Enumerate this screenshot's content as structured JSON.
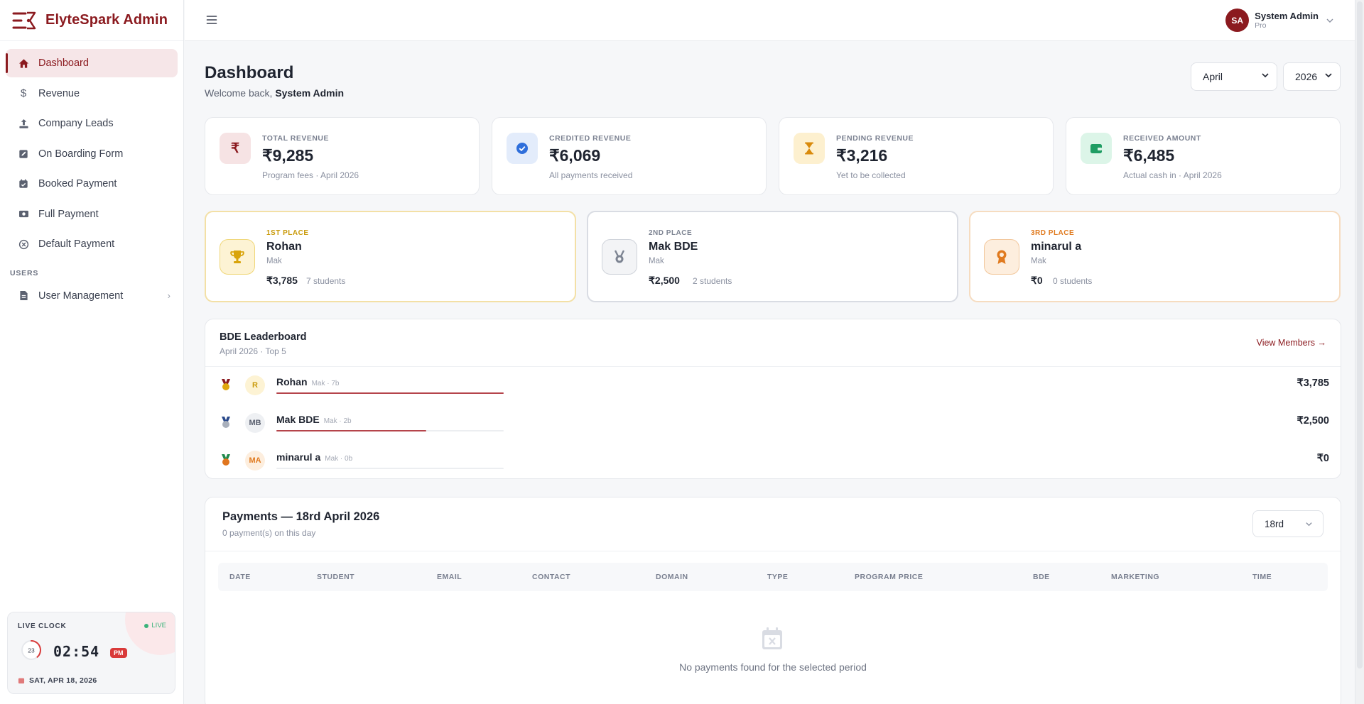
{
  "app": {
    "title": "ElyteSpark Admin"
  },
  "sidebar": {
    "items": [
      {
        "label": "Dashboard",
        "icon": "home-icon",
        "active": true
      },
      {
        "label": "Revenue",
        "icon": "dollar-icon"
      },
      {
        "label": "Company Leads",
        "icon": "upload-icon"
      },
      {
        "label": "On Boarding Form",
        "icon": "edit-icon"
      },
      {
        "label": "Booked Payment",
        "icon": "calendar-icon"
      },
      {
        "label": "Full Payment",
        "icon": "money-icon"
      },
      {
        "label": "Default Payment",
        "icon": "x-circle-icon"
      }
    ],
    "section_label": "USERS",
    "user_management": {
      "label": "User Management",
      "icon": "document-icon"
    }
  },
  "clock": {
    "label": "LIVE CLOCK",
    "live": "LIVE",
    "seconds": "23",
    "time": "02:54",
    "ampm": "PM",
    "date": "SAT, APR 18, 2026"
  },
  "header": {
    "user": {
      "initials": "SA",
      "name": "System Admin",
      "role": "Pro"
    }
  },
  "page": {
    "title": "Dashboard",
    "welcome_prefix": "Welcome back,",
    "welcome_name": "System Admin",
    "month_select": "April",
    "year_select": "2026"
  },
  "stats": [
    {
      "label": "TOTAL REVENUE",
      "value": "₹9,285",
      "sub": "Program fees · April 2026",
      "icon": "rupee-icon",
      "color": "#8b1a1f"
    },
    {
      "label": "CREDITED REVENUE",
      "value": "₹6,069",
      "sub": "All payments received",
      "icon": "check-circle-icon",
      "color": "#2f6fdb"
    },
    {
      "label": "PENDING REVENUE",
      "value": "₹3,216",
      "sub": "Yet to be collected",
      "icon": "hourglass-icon",
      "color": "#d98a0b"
    },
    {
      "label": "RECEIVED AMOUNT",
      "value": "₹6,485",
      "sub": "Actual cash in · April 2026",
      "icon": "wallet-icon",
      "color": "#1f9d63"
    }
  ],
  "podium": [
    {
      "rank": "1ST PLACE",
      "name": "Rohan",
      "team": "Mak",
      "amount": "₹3,785",
      "students": "7 students",
      "icon": "trophy-icon",
      "color": "#c99a0a"
    },
    {
      "rank": "2ND PLACE",
      "name": "Mak BDE",
      "team": "Mak",
      "amount": "₹2,500",
      "students": "2 students",
      "icon": "medal-icon",
      "color": "#7d8492"
    },
    {
      "rank": "3RD PLACE",
      "name": "minarul a",
      "team": "Mak",
      "amount": "₹0",
      "students": "0 students",
      "icon": "award-icon",
      "color": "#e07a1f"
    }
  ],
  "leaderboard": {
    "title": "BDE Leaderboard",
    "subtitle": "April 2026 · Top 5",
    "link": "View Members →",
    "rows": [
      {
        "initials": "R",
        "name": "Rohan",
        "meta": "Mak · 7b",
        "amount": "₹3,785",
        "progress": 1.0
      },
      {
        "initials": "MB",
        "name": "Mak BDE",
        "meta": "Mak · 2b",
        "amount": "₹2,500",
        "progress": 0.66
      },
      {
        "initials": "MA",
        "name": "minarul a",
        "meta": "Mak · 0b",
        "amount": "₹0",
        "progress": 0
      }
    ]
  },
  "payments": {
    "title": "Payments — 18rd April 2026",
    "subtitle": "0 payment(s) on this day",
    "day_select": "18rd",
    "columns": [
      "DATE",
      "STUDENT",
      "EMAIL",
      "CONTACT",
      "DOMAIN",
      "TYPE",
      "PROGRAM PRICE",
      "BDE",
      "MARKETING",
      "TIME"
    ],
    "empty": "No payments found for the selected period"
  }
}
